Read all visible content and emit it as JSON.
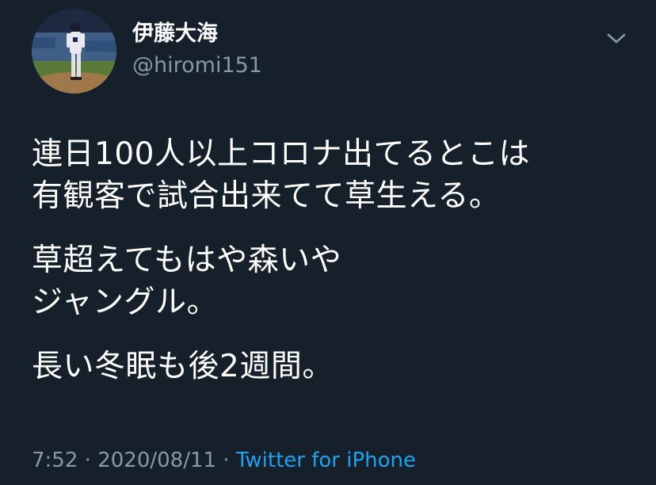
{
  "colors": {
    "background": "#15202b",
    "primary_text": "#ffffff",
    "secondary_text": "#8899a6",
    "link": "#1da1f2"
  },
  "user": {
    "display_name": "伊藤大海",
    "handle": "@hiromi151",
    "avatar_icon": "profile-photo-icon"
  },
  "menu": {
    "icon": "chevron-down-icon"
  },
  "tweet": {
    "paragraphs": [
      [
        "連日100人以上コロナ出てるとこは",
        "有観客で試合出来てて草生える。"
      ],
      [
        "草超えてもはや森いや",
        "ジャングル。"
      ],
      [
        "長い冬眠も後2週間。"
      ]
    ]
  },
  "meta": {
    "time": "7:52",
    "date": "2020/08/11",
    "separator": "·",
    "source": "Twitter for iPhone"
  }
}
